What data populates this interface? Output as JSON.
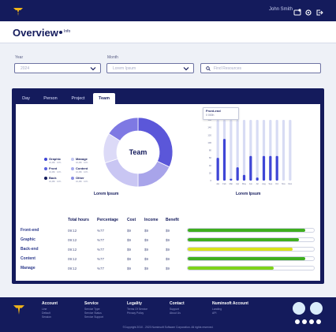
{
  "header": {
    "username": "John Smith"
  },
  "page": {
    "title": "Overview",
    "info_label": "Info"
  },
  "filters": {
    "year_label": "Year",
    "year_value": "2024",
    "month_label": "Month",
    "month_value": "Lorem Ipsum",
    "search_placeholder": "Find Resources"
  },
  "tabs": [
    {
      "label": "Day",
      "active": false
    },
    {
      "label": "Person",
      "active": false
    },
    {
      "label": "Project",
      "active": false
    },
    {
      "label": "Team",
      "active": true
    }
  ],
  "donut": {
    "center_label": "Team",
    "caption": "Lorem Ipsum",
    "legend": [
      {
        "name": "Graphic",
        "sub": "40,48h   10%",
        "color": "#3f46d6"
      },
      {
        "name": "Manage",
        "sub": "40,48h   10%",
        "color": "#c2c6f2"
      },
      {
        "name": "Front",
        "sub": "40,48h   10%",
        "color": "#5b62e0"
      },
      {
        "name": "Content",
        "sub": "40,48h   10%",
        "color": "#a8acef"
      },
      {
        "name": "Back",
        "sub": "40,48h   10%",
        "color": "#141b5c"
      },
      {
        "name": "Other",
        "sub": "40,48h   10%",
        "color": "#8b90e6"
      }
    ],
    "segments": [
      {
        "value": 32,
        "color": "#5b57d9"
      },
      {
        "value": 18,
        "color": "#a8a4ea"
      },
      {
        "value": 20,
        "color": "#c9c6f3"
      },
      {
        "value": 14,
        "color": "#dcdaf7"
      },
      {
        "value": 16,
        "color": "#7e79e3"
      }
    ]
  },
  "chart_data": {
    "type": "bar",
    "title": "",
    "xlabel": "Lorem Ipsum",
    "ylabel": "",
    "ylim": [
      0,
      160
    ],
    "yticks": [
      "160",
      "140",
      "120",
      "100",
      "80",
      "60",
      "40",
      "20",
      "0"
    ],
    "categories": [
      "Jan",
      "Feb",
      "Mar",
      "Apr",
      "May",
      "Jun",
      "Jul",
      "Aug",
      "Sep",
      "Oct",
      "Nov",
      "Dec"
    ],
    "series": [
      {
        "values": [
          60,
          110,
          5,
          35,
          15,
          65,
          8,
          65,
          65,
          65,
          0,
          0
        ],
        "color": "#3f46d6"
      }
    ],
    "tooltip": {
      "title": "Front-end",
      "sub": "0 000h"
    }
  },
  "table": {
    "columns": [
      "Total hours",
      "Percentage",
      "Cost",
      "Income",
      "Benefit"
    ],
    "rows": [
      {
        "label": "Front-end",
        "hours": "09:12",
        "pct": "%77",
        "cost": "$9",
        "income": "$9",
        "benefit": "$9",
        "progress": 0.93,
        "color": "#3fae1f"
      },
      {
        "label": "Graphic",
        "hours": "09:12",
        "pct": "%77",
        "cost": "$9",
        "income": "$9",
        "benefit": "$9",
        "progress": 0.88,
        "color": "#3fae1f"
      },
      {
        "label": "Back-end",
        "hours": "09:12",
        "pct": "%77",
        "cost": "$9",
        "income": "$9",
        "benefit": "$9",
        "progress": 0.83,
        "color": "#d9e21a"
      },
      {
        "label": "Content",
        "hours": "09:12",
        "pct": "%77",
        "cost": "$9",
        "income": "$9",
        "benefit": "$9",
        "progress": 0.93,
        "color": "#3fae1f"
      },
      {
        "label": "Manage",
        "hours": "09:12",
        "pct": "%77",
        "cost": "$9",
        "income": "$9",
        "benefit": "$9",
        "progress": 0.68,
        "color": "#7fd31b"
      }
    ]
  },
  "footer": {
    "columns": [
      {
        "heading": "Account",
        "links": [
          "Line",
          "Default",
          "Session"
        ]
      },
      {
        "heading": "Service",
        "links": [
          "Service Type",
          "Service Status",
          "Service Support"
        ]
      },
      {
        "heading": "Legality",
        "links": [
          "Terms Of Service",
          "Privacy Policy"
        ]
      },
      {
        "heading": "Contact",
        "links": [
          "Support",
          "About Us"
        ]
      },
      {
        "heading": "Numinsoft Account",
        "links": [
          "Landing",
          "API"
        ]
      }
    ],
    "copyright": "©Copyright 2010 - 2023 Numinsoft Software Corporation. All rights reserved."
  }
}
